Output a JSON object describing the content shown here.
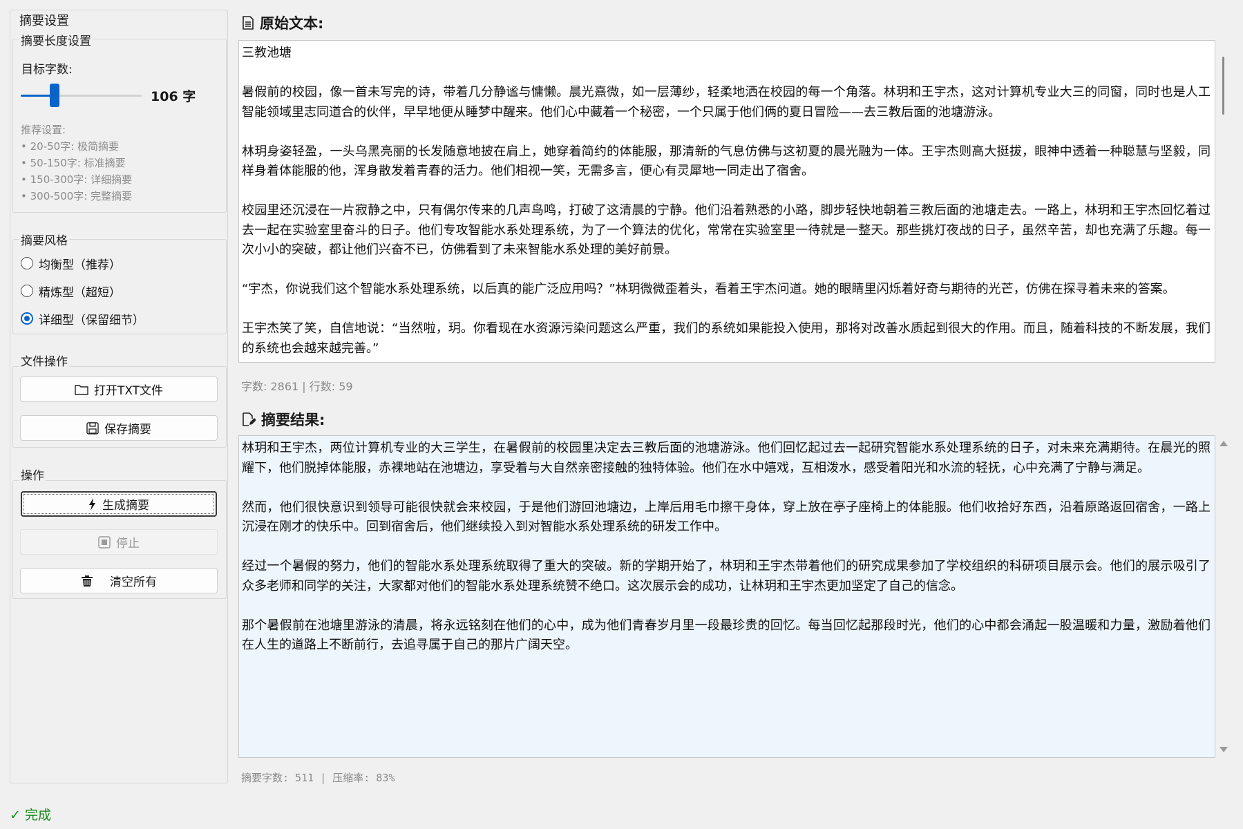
{
  "sidebar": {
    "group_title": "摘要设置",
    "length": {
      "title": "摘要长度设置",
      "target_label": "目标字数:",
      "slider_value": 106,
      "slider_min": 20,
      "slider_max": 500,
      "value_text": "106 字",
      "rec_title": "推荐设置:",
      "recs": [
        "• 20-50字: 极简摘要",
        "• 50-150字: 标准摘要",
        "• 150-300字: 详细摘要",
        "• 300-500字: 完整摘要"
      ]
    },
    "style": {
      "title": "摘要风格",
      "options": [
        "均衡型（推荐）",
        "精炼型（超短）",
        "详细型（保留细节）"
      ],
      "selected": 2
    },
    "file_ops": {
      "title": "文件操作",
      "open_label": "打开TXT文件",
      "save_label": "保存摘要"
    },
    "ops": {
      "title": "操作",
      "generate_label": "生成摘要",
      "stop_label": "停止",
      "clear_label": "清空所有"
    }
  },
  "original": {
    "title": "原始文本:",
    "stats": "字数: 2861 | 行数: 59",
    "paragraphs": [
      "三教池塘",
      "暑假前的校园，像一首未写完的诗，带着几分静谧与慵懒。晨光熹微，如一层薄纱，轻柔地洒在校园的每一个角落。林玥和王宇杰，这对计算机专业大三的同窗，同时也是人工智能领域里志同道合的伙伴，早早地便从睡梦中醒来。他们心中藏着一个秘密，一个只属于他们俩的夏日冒险——去三教后面的池塘游泳。",
      "林玥身姿轻盈，一头乌黑亮丽的长发随意地披在肩上，她穿着简约的体能服，那清新的气息仿佛与这初夏的晨光融为一体。王宇杰则高大挺拔，眼神中透着一种聪慧与坚毅，同样身着体能服的他，浑身散发着青春的活力。他们相视一笑，无需多言，便心有灵犀地一同走出了宿舍。",
      "校园里还沉浸在一片寂静之中，只有偶尔传来的几声鸟鸣，打破了这清晨的宁静。他们沿着熟悉的小路，脚步轻快地朝着三教后面的池塘走去。一路上，林玥和王宇杰回忆着过去一起在实验室里奋斗的日子。他们专攻智能水系处理系统，为了一个算法的优化，常常在实验室里一待就是一整天。那些挑灯夜战的日子，虽然辛苦，却也充满了乐趣。每一次小小的突破，都让他们兴奋不已，仿佛看到了未来智能水系处理的美好前景。",
      "“宇杰，你说我们这个智能水系处理系统，以后真的能广泛应用吗？”林玥微微歪着头，看着王宇杰问道。她的眼睛里闪烁着好奇与期待的光芒，仿佛在探寻着未来的答案。",
      "王宇杰笑了笑，自信地说：“当然啦，玥。你看现在水资源污染问题这么严重，我们的系统如果能投入使用，那将对改善水质起到很大的作用。而且，随着科技的不断发展，我们的系统也会越来越完善。”"
    ]
  },
  "summary": {
    "title": "摘要结果:",
    "stats": "摘要字数: 511 | 压缩率: 83%",
    "paragraphs": [
      "林玥和王宇杰，两位计算机专业的大三学生，在暑假前的校园里决定去三教后面的池塘游泳。他们回忆起过去一起研究智能水系处理系统的日子，对未来充满期待。在晨光的照耀下，他们脱掉体能服，赤裸地站在池塘边，享受着与大自然亲密接触的独特体验。他们在水中嬉戏，互相泼水，感受着阳光和水流的轻抚，心中充满了宁静与满足。",
      "然而，他们很快意识到领导可能很快就会来校园，于是他们游回池塘边，上岸后用毛巾擦干身体，穿上放在亭子座椅上的体能服。他们收拾好东西，沿着原路返回宿舍，一路上沉浸在刚才的快乐中。回到宿舍后，他们继续投入到对智能水系处理系统的研发工作中。",
      "经过一个暑假的努力，他们的智能水系处理系统取得了重大的突破。新的学期开始了，林玥和王宇杰带着他们的研究成果参加了学校组织的科研项目展示会。他们的展示吸引了众多老师和同学的关注，大家都对他们的智能水系处理系统赞不绝口。这次展示会的成功，让林玥和王宇杰更加坚定了自己的信念。",
      "那个暑假前在池塘里游泳的清晨，将永远铭刻在他们的心中，成为他们青春岁月里一段最珍贵的回忆。每当回忆起那段时光，他们的心中都会涌起一股温暖和力量，激励着他们在人生的道路上不断前行，去追寻属于自己的那片广阔天空。"
    ]
  },
  "status": {
    "text": "✓ 完成",
    "color": "#1a8c1a"
  },
  "colors": {
    "accent": "#0a63c9",
    "summary_bg": "#eef6fd"
  }
}
